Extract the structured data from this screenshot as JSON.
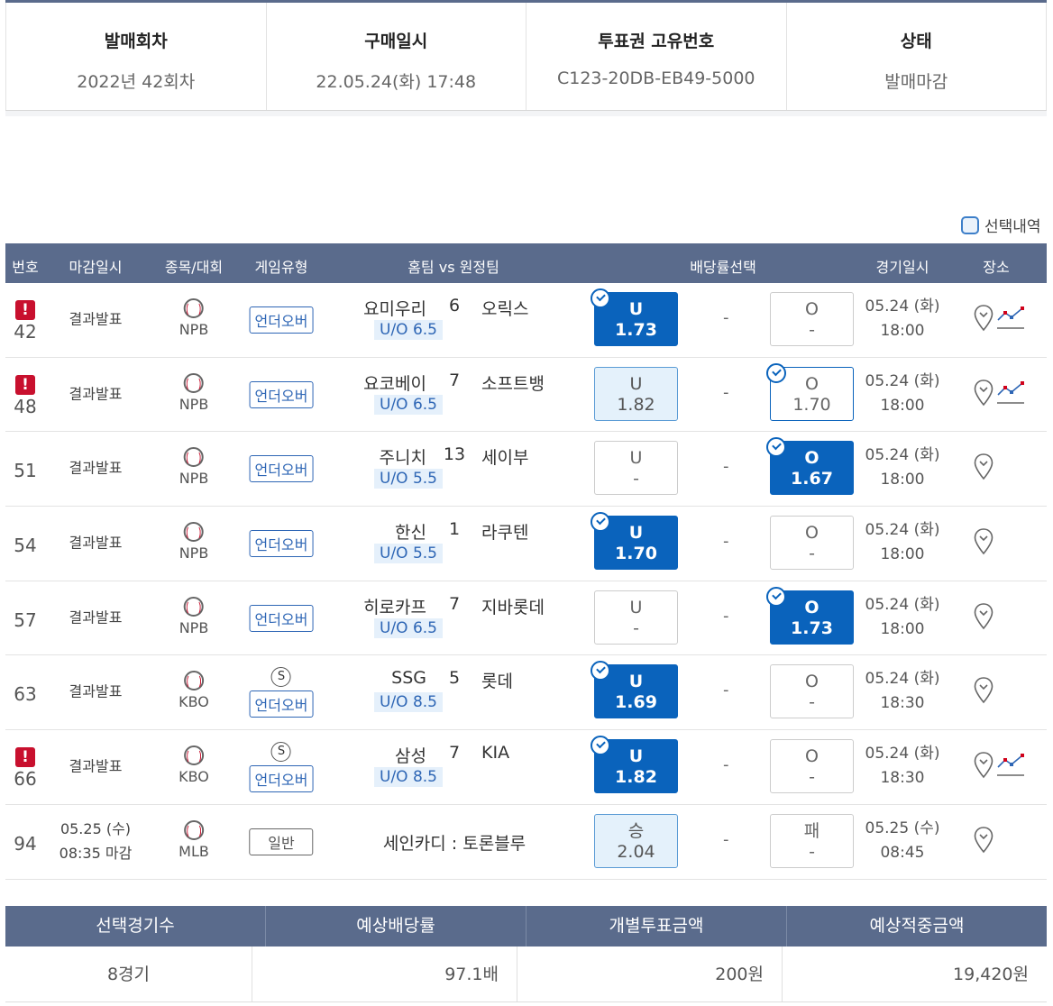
{
  "ticket": {
    "round_label": "발매회차",
    "round_value": "2022년 42회차",
    "purchase_label": "구매일시",
    "purchase_value": "22.05.24(화) 17:48",
    "serial_label": "투표권 고유번호",
    "serial_value": "C123-20DB-EB49-5000",
    "status_label": "상태",
    "status_value": "발매마감"
  },
  "select_history_label": "선택내역",
  "columns": {
    "no": "번호",
    "deadline": "마감일시",
    "sport": "종목/대회",
    "game_type": "게임유형",
    "teams": "홈팀 vs 원정팀",
    "odds": "배당률선택",
    "game_date": "경기일시",
    "venue": "장소"
  },
  "rows": [
    {
      "no": "42",
      "warn": "!",
      "deadline": "결과발표",
      "league": "NPB",
      "type": "언더오버",
      "home": "요미우리",
      "score": "6",
      "away": "오릭스",
      "handicap": "U/O 6.5",
      "left_label": "U",
      "left_odds": "1.73",
      "dash": "-",
      "right_label": "O",
      "right_odds": "-",
      "date": "05.24 (화)",
      "time": "18:00"
    },
    {
      "no": "48",
      "warn": "!",
      "deadline": "결과발표",
      "league": "NPB",
      "type": "언더오버",
      "home": "요코베이",
      "score": "7",
      "away": "소프트뱅",
      "handicap": "U/O 6.5",
      "left_label": "U",
      "left_odds": "1.82",
      "dash": "-",
      "right_label": "O",
      "right_odds": "1.70",
      "date": "05.24 (화)",
      "time": "18:00"
    },
    {
      "no": "51",
      "deadline": "결과발표",
      "league": "NPB",
      "type": "언더오버",
      "home": "주니치",
      "score": "13",
      "away": "세이부",
      "handicap": "U/O 5.5",
      "left_label": "U",
      "left_odds": "-",
      "dash": "-",
      "right_label": "O",
      "right_odds": "1.67",
      "date": "05.24 (화)",
      "time": "18:00"
    },
    {
      "no": "54",
      "deadline": "결과발표",
      "league": "NPB",
      "type": "언더오버",
      "home": "한신",
      "score": "1",
      "away": "라쿠텐",
      "handicap": "U/O 5.5",
      "left_label": "U",
      "left_odds": "1.70",
      "dash": "-",
      "right_label": "O",
      "right_odds": "-",
      "date": "05.24 (화)",
      "time": "18:00"
    },
    {
      "no": "57",
      "deadline": "결과발표",
      "league": "NPB",
      "type": "언더오버",
      "home": "히로카프",
      "score": "7",
      "away": "지바롯데",
      "handicap": "U/O 6.5",
      "left_label": "U",
      "left_odds": "-",
      "dash": "-",
      "right_label": "O",
      "right_odds": "1.73",
      "date": "05.24 (화)",
      "time": "18:00"
    },
    {
      "no": "63",
      "deadline": "결과발표",
      "league": "KBO",
      "badge": "S",
      "type": "언더오버",
      "home": "SSG",
      "score": "5",
      "away": "롯데",
      "handicap": "U/O 8.5",
      "left_label": "U",
      "left_odds": "1.69",
      "dash": "-",
      "right_label": "O",
      "right_odds": "-",
      "date": "05.24 (화)",
      "time": "18:30"
    },
    {
      "no": "66",
      "warn": "!",
      "deadline": "결과발표",
      "league": "KBO",
      "badge": "S",
      "type": "언더오버",
      "home": "삼성",
      "score": "7",
      "away": "KIA",
      "handicap": "U/O 8.5",
      "left_label": "U",
      "left_odds": "1.82",
      "dash": "-",
      "right_label": "O",
      "right_odds": "-",
      "date": "05.24 (화)",
      "time": "18:30"
    },
    {
      "no": "94",
      "deadline_date": "05.25 (수)",
      "deadline_time": "08:35 마감",
      "league": "MLB",
      "type": "일반",
      "match": "세인카디 : 토론블루",
      "left_label": "승",
      "left_odds": "2.04",
      "dash": "-",
      "right_label": "패",
      "right_odds": "-",
      "date": "05.25 (수)",
      "time": "08:45"
    }
  ],
  "summary": {
    "count_label": "선택경기수",
    "odds_label": "예상배당률",
    "stake_label": "개별투표금액",
    "payout_label": "예상적중금액",
    "count_value": "8경기",
    "odds_value": "97.1배",
    "stake_value": "200원",
    "payout_value": "19,420원"
  },
  "colors": {
    "header_bg": "#5a6b8c",
    "selected_odds": "#0a63bc",
    "hit_odds_bg": "#e4f1fb",
    "warning": "#c8102e"
  }
}
